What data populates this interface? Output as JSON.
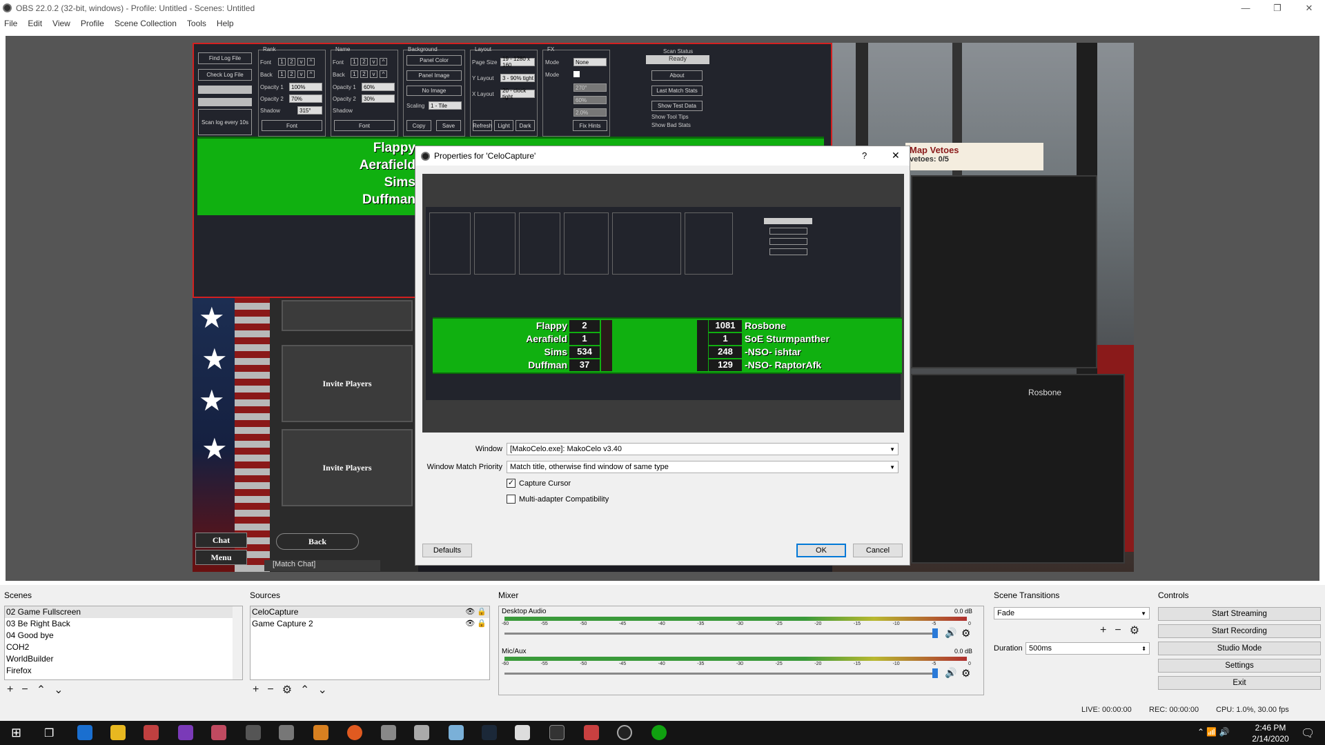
{
  "window": {
    "title": "OBS 22.0.2 (32-bit, windows) - Profile: Untitled - Scenes: Untitled",
    "minimize": "—",
    "maximize": "❐",
    "close": "✕"
  },
  "menu": [
    "File",
    "Edit",
    "View",
    "Profile",
    "Scene Collection",
    "Tools",
    "Help"
  ],
  "celo": {
    "buttons": {
      "find_log": "Find Log File",
      "check_log": "Check Log File",
      "scan_every": "Scan log every 10s"
    },
    "rank": {
      "label": "Rank",
      "font": "Font",
      "back": "Back",
      "opacity1": "Opacity 1",
      "opacity2": "Opacity 2",
      "shadow": "Shadow",
      "op1_val": "100%",
      "op2_val": "70%",
      "shadow_val": "315°",
      "font_btn": "Font"
    },
    "name": {
      "label": "Name",
      "font": "Font",
      "back": "Back",
      "opacity1": "Opacity 1",
      "opacity2": "Opacity 2",
      "shadow": "Shadow",
      "op1_val": "60%",
      "op2_val": "30%",
      "font_btn": "Font"
    },
    "background": {
      "label": "Background",
      "panel_color": "Panel Color",
      "panel_image": "Panel Image",
      "no_image": "No Image",
      "scaling": "Scaling",
      "scaling_val": "1 - Tile",
      "copy": "Copy",
      "save": "Save"
    },
    "layout": {
      "label": "Layout",
      "page_size": "Page Size",
      "page_size_val": "19 - 1280 x 160",
      "y_layout": "Y Layout",
      "y_layout_val": "3 - 90% tight",
      "x_layout": "X Layout",
      "x_layout_val": "20 - clock tight",
      "refresh": "Refresh",
      "light": "Light",
      "dark": "Dark"
    },
    "fx": {
      "label": "FX",
      "mode": "Mode",
      "mode_val": "None",
      "mode2": "Mode",
      "v1": "270°",
      "v2": "60%",
      "v3": "2.0%",
      "fix_hints": "Fix Hints"
    },
    "scan": {
      "label": "Scan Status",
      "ready": "Ready",
      "about": "About",
      "last_match": "Last Match Stats",
      "show_test": "Show Test Data",
      "tooltips": "Show Tool Tips",
      "bad_stats": "Show Bad Stats"
    },
    "digits": [
      "1",
      "2",
      "v",
      "^"
    ]
  },
  "game": {
    "names_left": [
      "Flappy",
      "Aerafield",
      "Sims",
      "Duffman"
    ],
    "invite": "Invite Players",
    "chat": "Chat",
    "menu": "Menu",
    "back": "Back",
    "match_chat": "[Match Chat]",
    "map_vetoes": "Map Vetoes",
    "vetoes_count": "vetoes: 0/5",
    "player": "Rosbone"
  },
  "dialog": {
    "title": "Properties for 'CeloCapture'",
    "help": "?",
    "close": "✕",
    "preview": {
      "left": [
        {
          "name": "Flappy",
          "num": "2"
        },
        {
          "name": "Aerafield",
          "num": "1"
        },
        {
          "name": "Sims",
          "num": "534"
        },
        {
          "name": "Duffman",
          "num": "37"
        }
      ],
      "right": [
        {
          "name": "Rosbone",
          "num": "1081"
        },
        {
          "name": "SoE Sturmpanther",
          "num": "1"
        },
        {
          "name": "-NSO- ishtar",
          "num": "248"
        },
        {
          "name": "-NSO- RaptorAfk",
          "num": "129"
        }
      ]
    },
    "window_label": "Window",
    "window_val": "[MakoCelo.exe]: MakoCelo v3.40",
    "priority_label": "Window Match Priority",
    "priority_val": "Match title, otherwise find window of same type",
    "capture_cursor": "Capture Cursor",
    "multi_adapter": "Multi-adapter Compatibility",
    "defaults": "Defaults",
    "ok": "OK",
    "cancel": "Cancel"
  },
  "scenes": {
    "title": "Scenes",
    "items": [
      "02 Game Fullscreen",
      "03 Be Right Back",
      "04 Good bye",
      "COH2",
      "WorldBuilder",
      "Firefox"
    ]
  },
  "sources": {
    "title": "Sources",
    "items": [
      "CeloCapture",
      "Game Capture 2"
    ]
  },
  "mixer": {
    "title": "Mixer",
    "channels": [
      {
        "name": "Desktop Audio",
        "db": "0.0 dB"
      },
      {
        "name": "Mic/Aux",
        "db": "0.0 dB"
      }
    ],
    "ticks": [
      "-60",
      "-55",
      "-50",
      "-45",
      "-40",
      "-35",
      "-30",
      "-25",
      "-20",
      "-15",
      "-10",
      "-5",
      "0"
    ]
  },
  "transitions": {
    "title": "Scene Transitions",
    "value": "Fade",
    "duration_label": "Duration",
    "duration_val": "500ms"
  },
  "controls": {
    "title": "Controls",
    "buttons": [
      "Start Streaming",
      "Start Recording",
      "Studio Mode",
      "Settings",
      "Exit"
    ]
  },
  "status": {
    "live": "LIVE: 00:00:00",
    "rec": "REC: 00:00:00",
    "cpu": "CPU: 1.0%, 30.00 fps"
  },
  "clock": {
    "time": "2:46 PM",
    "date": "2/14/2020"
  }
}
